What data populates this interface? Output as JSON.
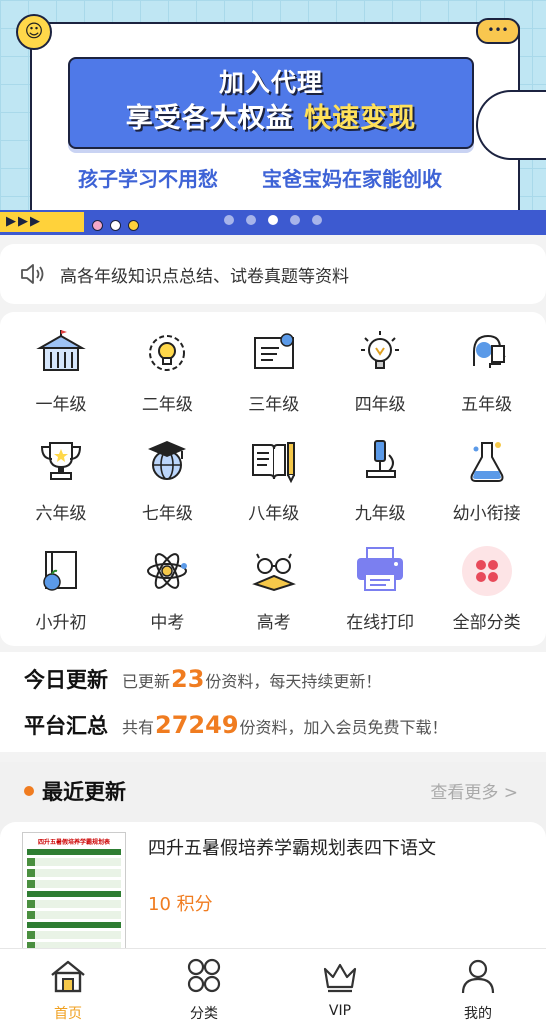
{
  "banner": {
    "headline_1": "加入代理",
    "headline_2a": "享受各大权益",
    "headline_2b": "快速变现",
    "subline_left": "孩子学习不用愁",
    "subline_right": "宝爸宝妈在家能创收",
    "bubble_text": "•••",
    "arrows_text": "▶▶▶",
    "pager_count": 5,
    "pager_active": 2
  },
  "notice": {
    "text": "高各年级知识点总结、试卷真题等资料"
  },
  "categories": [
    {
      "label": "一年级",
      "icon": "school-building-icon"
    },
    {
      "label": "二年级",
      "icon": "lightbulb-gear-icon"
    },
    {
      "label": "三年级",
      "icon": "certificate-icon"
    },
    {
      "label": "四年级",
      "icon": "idea-bulb-icon"
    },
    {
      "label": "五年级",
      "icon": "head-book-icon"
    },
    {
      "label": "六年级",
      "icon": "trophy-icon"
    },
    {
      "label": "七年级",
      "icon": "graduation-globe-icon"
    },
    {
      "label": "八年级",
      "icon": "open-book-pencil-icon"
    },
    {
      "label": "九年级",
      "icon": "microscope-icon"
    },
    {
      "label": "幼小衔接",
      "icon": "flask-icon"
    },
    {
      "label": "小升初",
      "icon": "book-apple-icon"
    },
    {
      "label": "中考",
      "icon": "atom-icon"
    },
    {
      "label": "高考",
      "icon": "glasses-book-icon"
    },
    {
      "label": "在线打印",
      "icon": "printer-icon"
    },
    {
      "label": "全部分类",
      "icon": "all-categories-icon"
    }
  ],
  "stats": {
    "today_label": "今日更新",
    "today_prefix": "已更新",
    "today_count": "23",
    "today_suffix": "份资料，每天持续更新！",
    "total_label": "平台汇总",
    "total_prefix": "共有",
    "total_count": "27249",
    "total_suffix": "份资料，加入会员免费下载！"
  },
  "recent": {
    "title": "最近更新",
    "more": "查看更多 >",
    "item": {
      "name": "四升五暑假培养学霸规划表四下语文",
      "points": "10 积分",
      "thumb_title": "四升五暑假培养学霸规划表"
    }
  },
  "tabs": [
    {
      "label": "首页",
      "icon": "home-icon",
      "active": true
    },
    {
      "label": "分类",
      "icon": "grid-circles-icon",
      "active": false
    },
    {
      "label": "VIP",
      "icon": "crown-icon",
      "active": false
    },
    {
      "label": "我的",
      "icon": "user-icon",
      "active": false
    }
  ],
  "colors": {
    "accent": "#f07c20",
    "tab_active": "#f0a020",
    "banner_blue": "#4f79e8"
  }
}
